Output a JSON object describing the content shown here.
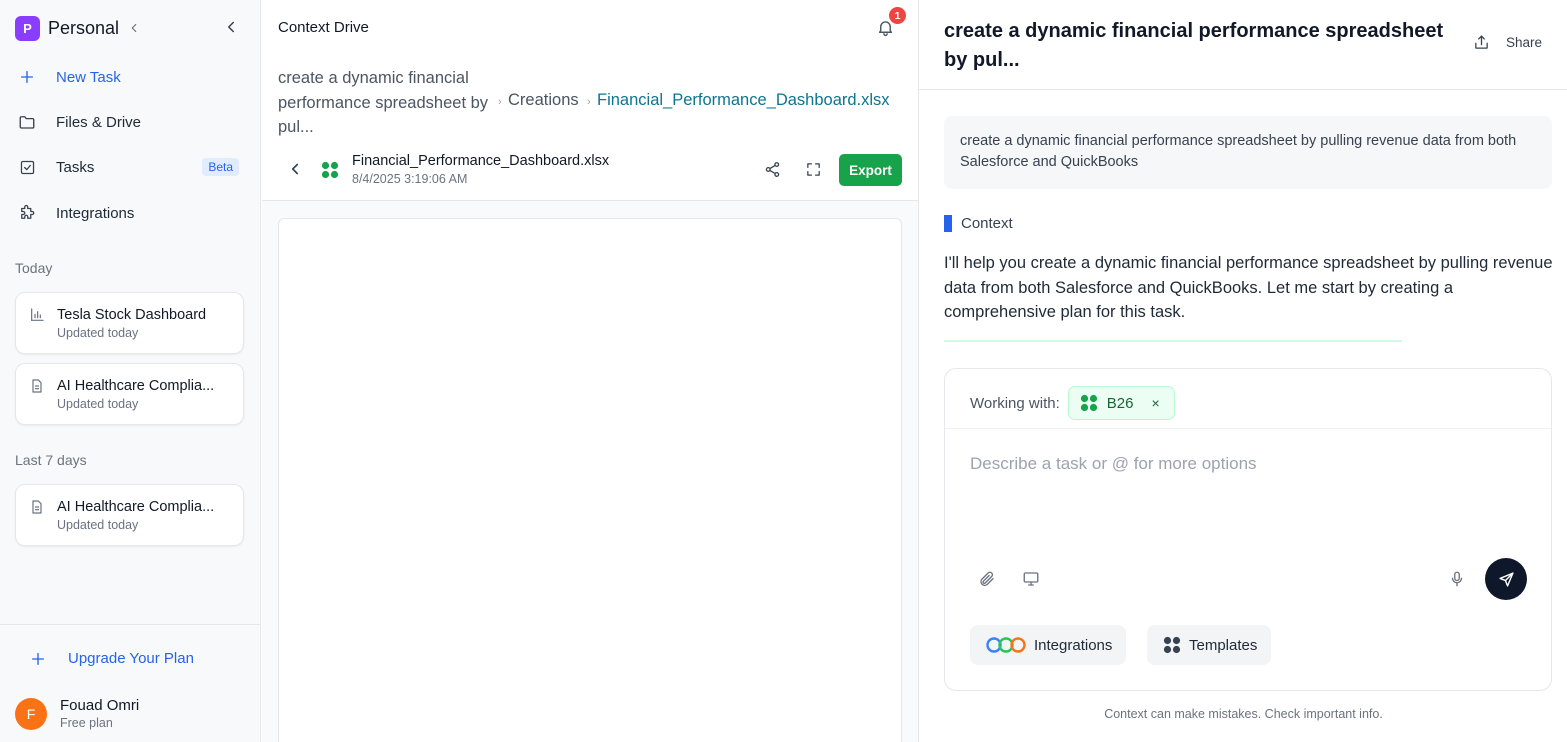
{
  "sidebar": {
    "workspace": {
      "initial": "P",
      "name": "Personal"
    },
    "nav": {
      "new_task": "New Task",
      "files": "Files & Drive",
      "tasks": "Tasks",
      "tasks_badge": "Beta",
      "integrations": "Integrations"
    },
    "sections": {
      "today": "Today",
      "last7": "Last 7 days"
    },
    "today_items": [
      {
        "title": "Tesla Stock Dashboard",
        "subtitle": "Updated today",
        "icon": "bar-chart-icon"
      },
      {
        "title": "AI Healthcare Complia...",
        "subtitle": "Updated today",
        "icon": "document-icon"
      }
    ],
    "last7_items": [
      {
        "title": "AI Healthcare Complia...",
        "subtitle": "Updated today",
        "icon": "document-icon"
      }
    ],
    "upgrade": "Upgrade Your Plan",
    "user": {
      "initial": "F",
      "name": "Fouad Omri",
      "plan": "Free plan"
    }
  },
  "drive": {
    "title": "Context Drive",
    "notification_count": "1",
    "breadcrumb": {
      "task": "create a dynamic financial performance spreadsheet by pul...",
      "folder": "Creations",
      "file": "Financial_Performance_Dashboard.xlsx"
    },
    "file": {
      "name": "Financial_Performance_Dashboard.xlsx",
      "date": "8/4/2025 3:19:06 AM"
    },
    "export_label": "Export"
  },
  "chat": {
    "title": "create a dynamic financial performance spreadsheet by pul...",
    "share_label": "Share",
    "user_prompt": "create a dynamic financial performance spreadsheet by pulling revenue data from both Salesforce and QuickBooks",
    "assistant_label": "Context",
    "assistant_message": "I'll help you create a dynamic financial performance spreadsheet by pulling revenue data from both Salesforce and QuickBooks. Let me start by creating a comprehensive plan for this task.",
    "composer": {
      "working_with": "Working with:",
      "chip_label": "B26",
      "chip_close": "×",
      "placeholder": "Describe a task or @ for more options",
      "integrations_label": "Integrations",
      "templates_label": "Templates"
    },
    "footnote": "Context can make mistakes. Check important info."
  },
  "colors": {
    "accent": "#2563eb",
    "export_green": "#16a34a",
    "workspace_purple": "#8b3dff",
    "avatar_orange": "#f97316",
    "notification_red": "#ef4444"
  }
}
